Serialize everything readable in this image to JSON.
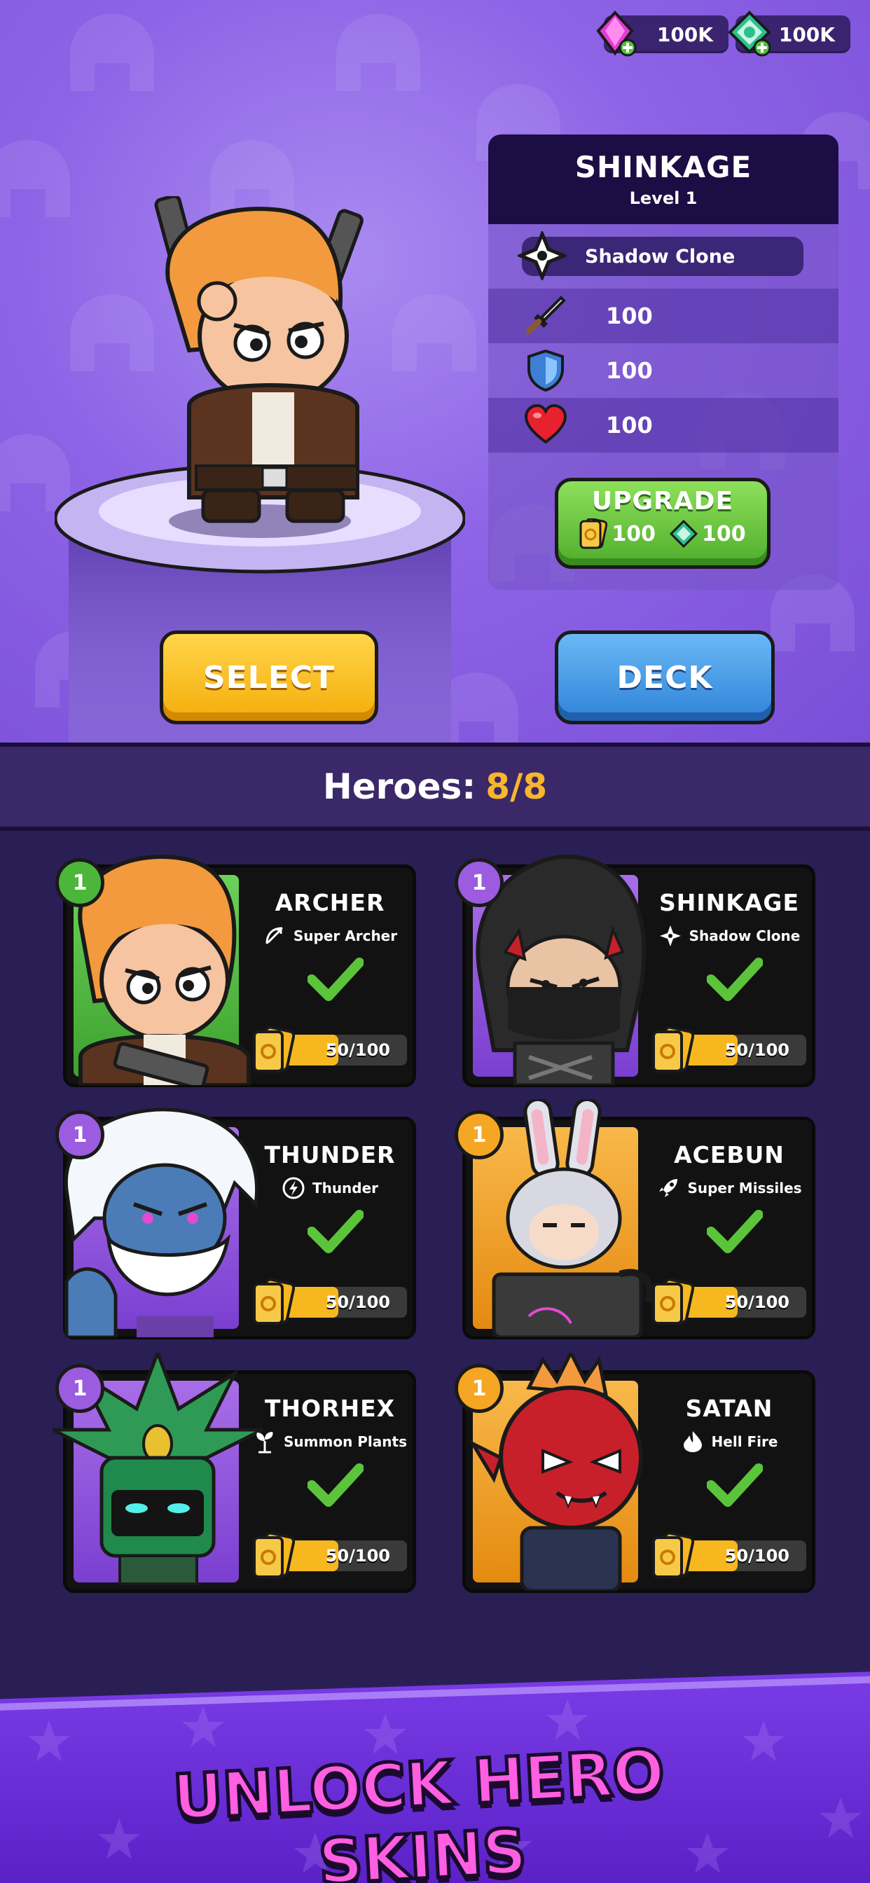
{
  "currency": {
    "gems": "100K",
    "tokens": "100K"
  },
  "selected_hero": {
    "name": "SHINKAGE",
    "level": "Level 1",
    "ability": "Shadow Clone",
    "attack": "100",
    "defense": "100",
    "health": "100"
  },
  "upgrade": {
    "label": "UPGRADE",
    "card_cost": "100",
    "token_cost": "100"
  },
  "buttons": {
    "select": "SELECT",
    "deck": "DECK"
  },
  "heroes_header": {
    "label": "Heroes:",
    "count": "8/8"
  },
  "heroes": [
    {
      "name": "ARCHER",
      "skill": "Super Archer",
      "level": "1",
      "progress": "50/100",
      "progress_fraction": 0.5,
      "rarity": "common"
    },
    {
      "name": "SHINKAGE",
      "skill": "Shadow Clone",
      "level": "1",
      "progress": "50/100",
      "progress_fraction": 0.5,
      "rarity": "epic"
    },
    {
      "name": "THUNDER",
      "skill": "Thunder",
      "level": "1",
      "progress": "50/100",
      "progress_fraction": 0.5,
      "rarity": "epic"
    },
    {
      "name": "ACEBUN",
      "skill": "Super Missiles",
      "level": "1",
      "progress": "50/100",
      "progress_fraction": 0.5,
      "rarity": "legendary"
    },
    {
      "name": "THORHEX",
      "skill": "Summon Plants",
      "level": "1",
      "progress": "50/100",
      "progress_fraction": 0.5,
      "rarity": "epic"
    },
    {
      "name": "SATAN",
      "skill": "Hell Fire",
      "level": "1",
      "progress": "50/100",
      "progress_fraction": 0.5,
      "rarity": "legendary"
    }
  ],
  "banner": {
    "text": "UNLOCK HERO SKINS"
  },
  "colors": {
    "common": "#4cb63a",
    "epic": "#9b5ce0",
    "legendary": "#f5a623",
    "accent_gold": "#f8b62c"
  }
}
